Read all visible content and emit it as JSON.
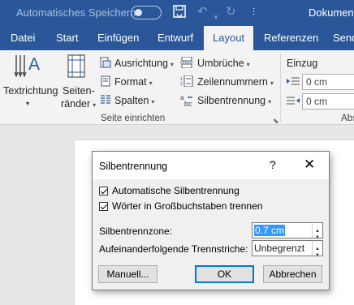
{
  "titlebar": {
    "autosave_label": "Automatisches Speichern",
    "doc_title": "Dokument"
  },
  "tabs": [
    "Datei",
    "Start",
    "Einfügen",
    "Entwurf",
    "Layout",
    "Referenzen",
    "Send"
  ],
  "active_tab": "Layout",
  "ribbon": {
    "textrichtung": "Textrichtung",
    "seitenraender_line1": "Seiten-",
    "seitenraender_line2": "ränder",
    "ausrichtung": "Ausrichtung",
    "format": "Format",
    "spalten": "Spalten",
    "umbrueche": "Umbrüche",
    "zeilennummern": "Zeilennummern",
    "silbentrennung": "Silbentrennung",
    "group_label": "Seite einrichten",
    "einzug_label": "Einzug",
    "einzug_left_value": "0 cm",
    "einzug_right_value": "0 cm",
    "abs_label": "Abs"
  },
  "dialog": {
    "title": "Silbentrennung",
    "help": "?",
    "close": "✕",
    "auto_label": "Automatische Silbentrennung",
    "auto_checked": true,
    "caps_label": "Wörter in Großbuchstaben trennen",
    "caps_checked": true,
    "zone_label": "Silbentrennzone:",
    "zone_value": "0.7 cm",
    "consec_label": "Aufeinanderfolgende Trennstriche:",
    "consec_value": "Unbegrenzt",
    "manual_button": "Manuell...",
    "ok_button": "OK",
    "cancel_button": "Abbrechen"
  }
}
